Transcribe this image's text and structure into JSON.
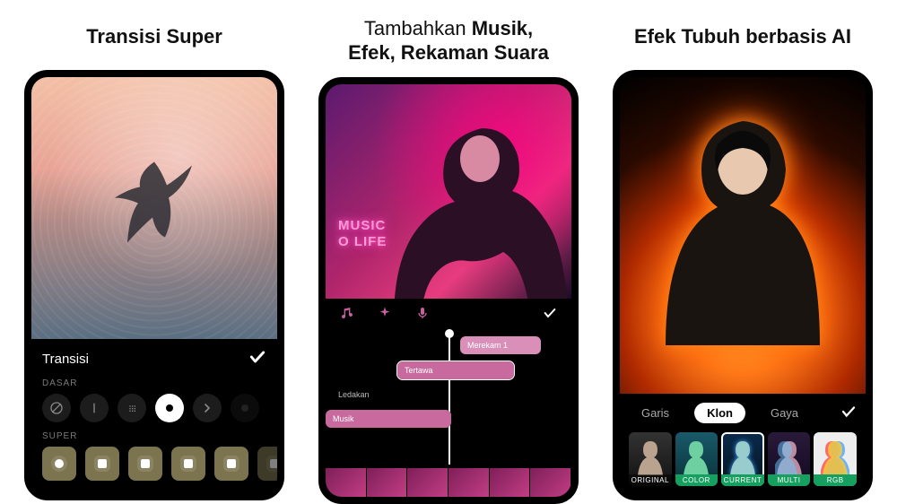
{
  "panels": {
    "transisi": {
      "title": "Transisi Super",
      "header_label": "Transisi",
      "section_basic": "DASAR",
      "section_super": "SUPER"
    },
    "musik": {
      "title_plain": "Tambahkan ",
      "title_bold": "Musik,\nEfek, Rekaman Suara",
      "neon_line1": "MUSIC",
      "neon_line2": "O LIFE",
      "clips": {
        "merekam": "Merekam 1",
        "tertawa": "Tertawa",
        "ledakan": "Ledakan",
        "musik": "Musik"
      }
    },
    "ai": {
      "title": "Efek Tubuh berbasis AI",
      "tabs": {
        "garis": "Garis",
        "klon": "Klon",
        "gaya": "Gaya"
      },
      "thumbs": {
        "original": "ORIGINAL",
        "color": "COLOR",
        "current": "CURRENT",
        "multi": "MULTI",
        "rgb": "RGB"
      }
    }
  },
  "colors": {
    "accent_pink": "#c85fa0",
    "accent_fire": "#ff7b1a"
  }
}
